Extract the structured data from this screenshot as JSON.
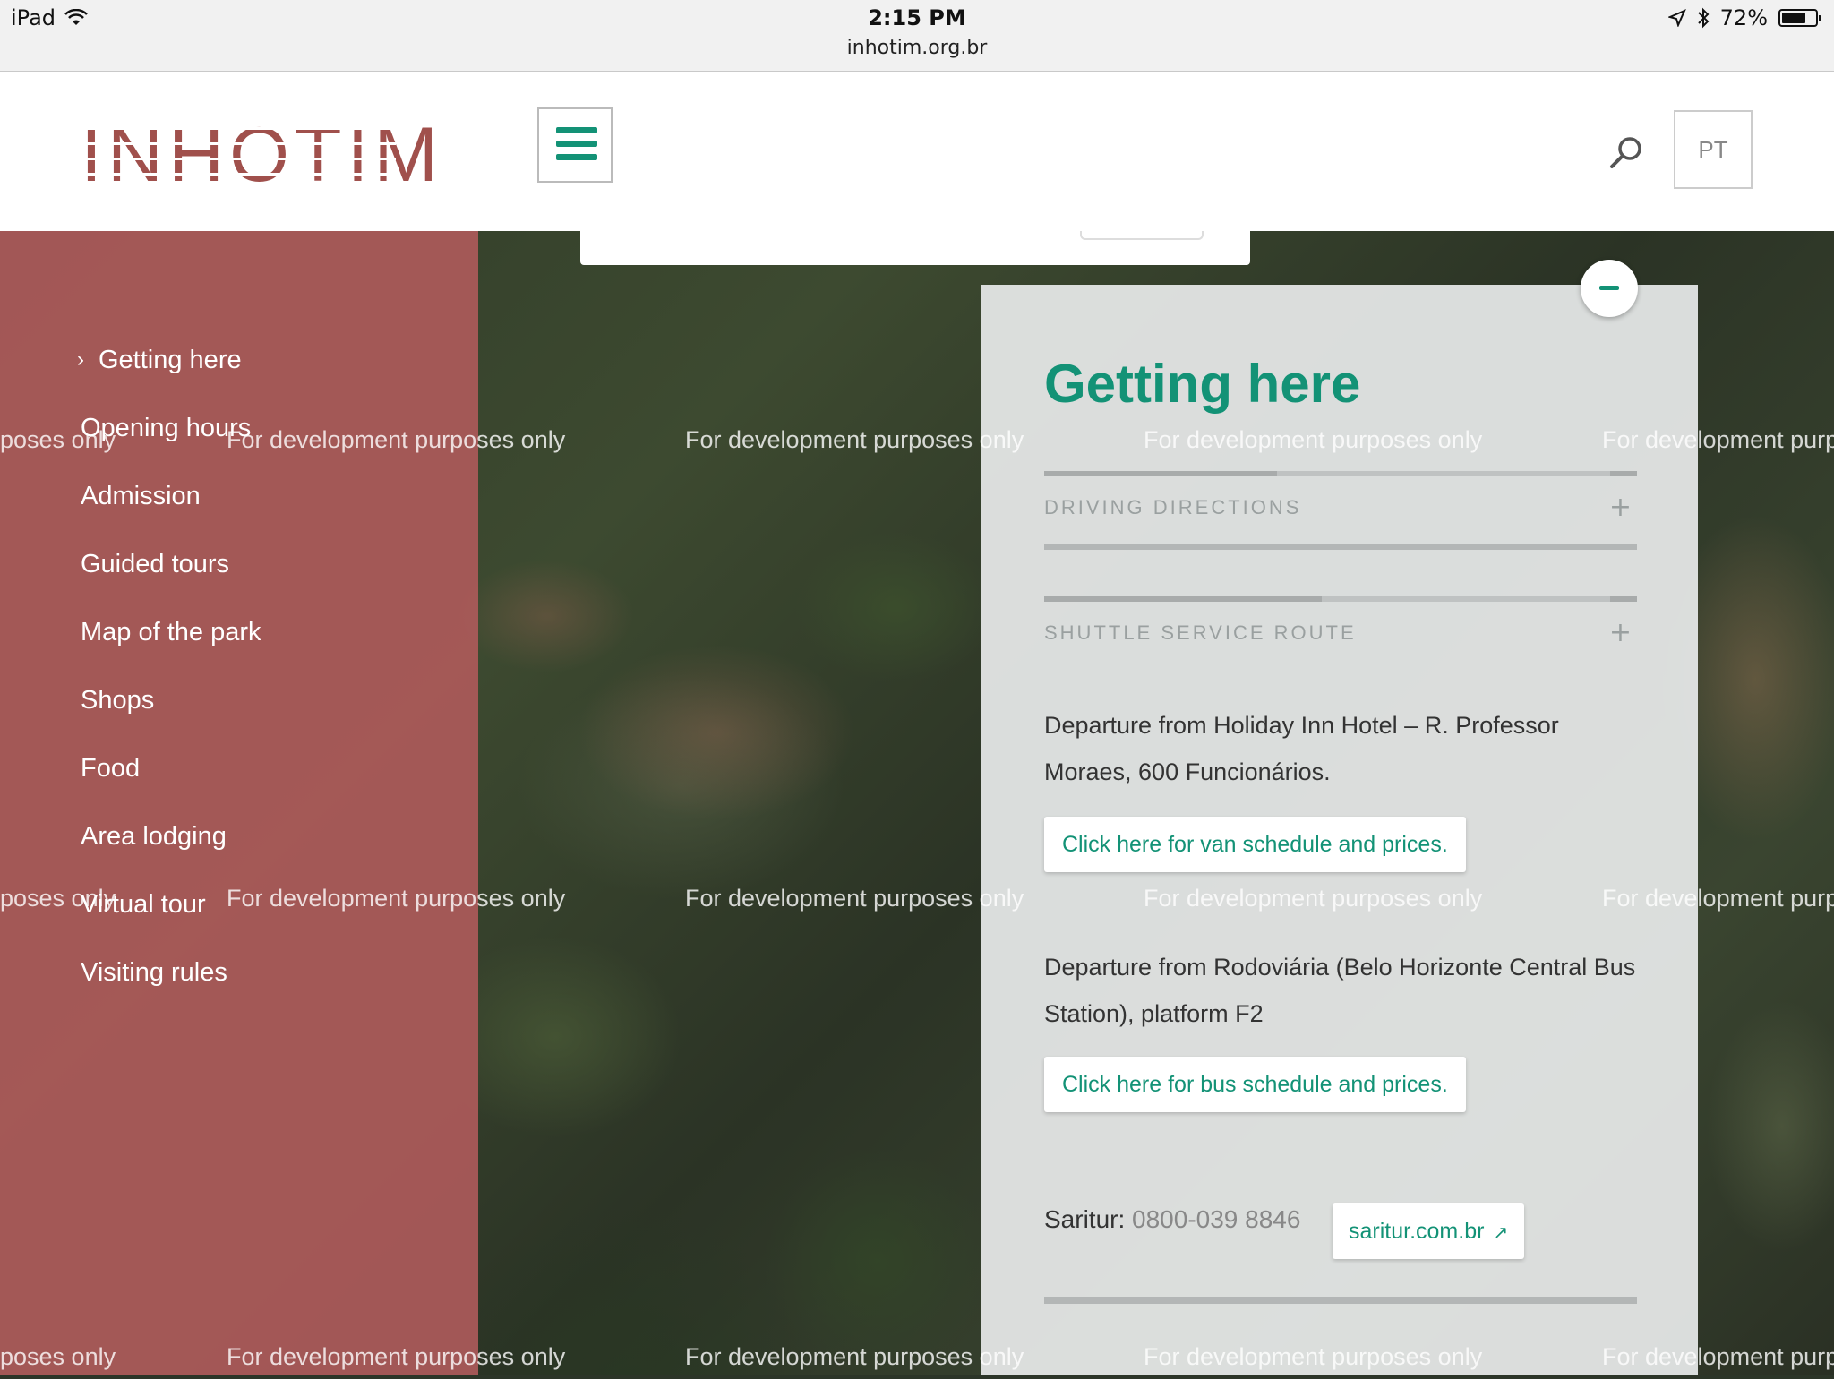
{
  "status_bar": {
    "device": "iPad",
    "time": "2:15 PM",
    "url": "inhotim.org.br",
    "battery": "72%",
    "battery_level": 0.72
  },
  "header": {
    "logo": "INHOTIM",
    "language_button": "PT",
    "icons": {
      "menu": "hamburger-menu-icon",
      "search": "search-icon"
    }
  },
  "sidebar": {
    "items": [
      {
        "label": "Getting here",
        "active": true
      },
      {
        "label": "Opening hours"
      },
      {
        "label": "Admission"
      },
      {
        "label": "Guided tours"
      },
      {
        "label": "Map of the park"
      },
      {
        "label": "Shops"
      },
      {
        "label": "Food"
      },
      {
        "label": "Area lodging"
      },
      {
        "label": "Virtual tour"
      },
      {
        "label": "Visiting rules"
      }
    ]
  },
  "panel": {
    "title": "Getting here",
    "collapse_icon": "minus-icon",
    "accordions": [
      {
        "label": "DRIVING DIRECTIONS",
        "icon": "+"
      },
      {
        "label": "SHUTTLE SERVICE ROUTE",
        "icon": "+"
      }
    ],
    "departure_1": "Departure from Holiday Inn Hotel – R. Professor Moraes, 600  Funcionários.",
    "van_link": "Click here for van schedule and prices.",
    "departure_2": "Departure from Rodoviária (Belo Horizonte Central Bus Station), platform F2",
    "bus_link": "Click here for bus schedule and prices.",
    "saritur_label": "Saritur:",
    "saritur_phone": "0800-039 8846",
    "saritur_link": "saritur.com.br"
  },
  "watermark": "For development purposes only",
  "watermark_start": "poses only",
  "watermark_end": "For development purp",
  "colors": {
    "accent": "#139276",
    "sidebar_bg": "#ad5a5a",
    "logo": "#a0504c"
  }
}
